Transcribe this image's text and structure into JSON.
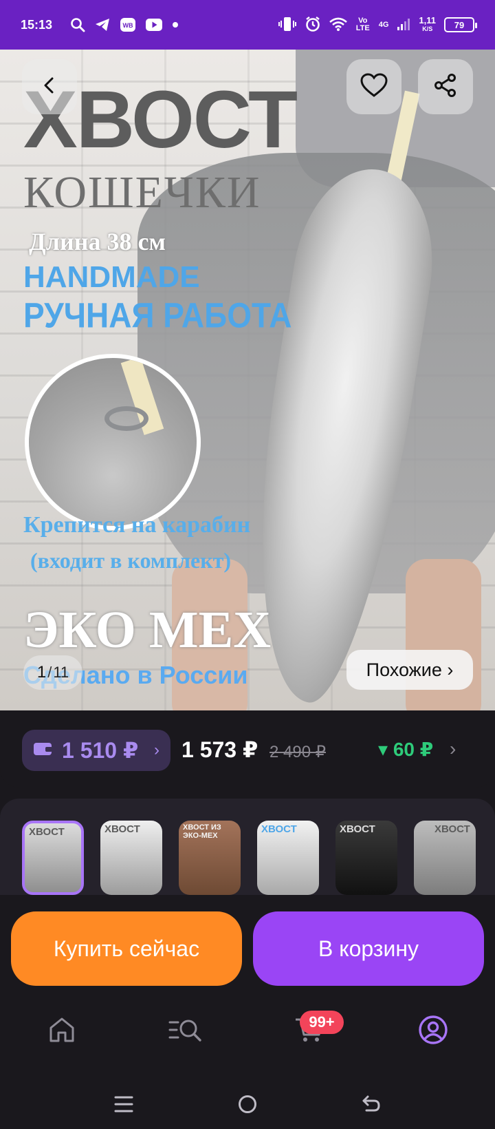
{
  "status_bar": {
    "time": "15:13",
    "network_type": "4G",
    "volte": "Vo LTE",
    "speed": "1,11",
    "speed_unit": "K/S",
    "battery": "79",
    "icons": [
      "search-icon",
      "telegram-icon",
      "wb-icon",
      "youtube-icon",
      "dot-icon",
      "vibrate-icon",
      "alarm-icon",
      "wifi-icon",
      "signal-icon",
      "battery-icon"
    ],
    "wb_label": "WB"
  },
  "hero": {
    "title": "ХВОСТ",
    "subtitle": "КОШЕЧКИ",
    "length_label": "Длина  38 см",
    "handmade_en": "HANDMADE",
    "handmade_ru": "РУЧНАЯ РАБОТА",
    "clip_line1": "Крепится на карабин",
    "clip_line2": "(входит в комплект)",
    "eco": "ЭКО МЕХ",
    "made_in": "Сделано в России",
    "page_current": "1",
    "page_separator": "/",
    "page_total": "11",
    "similar_label": "Похожие ›",
    "icons": [
      "back-icon",
      "heart-icon",
      "share-icon"
    ]
  },
  "price": {
    "wallet_price": "1 510 ₽",
    "wallet_chevron": "›",
    "main_price": "1 573 ₽",
    "old_price": "2 490 ₽",
    "cashback": "▾ 60 ₽",
    "chevron": "›",
    "colors": {
      "wallet": "#a98bef",
      "cashback": "#2ecb7a"
    }
  },
  "thumbnails": {
    "active_index": 0,
    "items": [
      {
        "label": "ХВОСТ"
      },
      {
        "label": "ХВОСТ"
      },
      {
        "label": "ХВОСТ ИЗ ЭКО-МЕХ"
      },
      {
        "label": "ХВОСТ"
      },
      {
        "label": "ХВОСТ"
      },
      {
        "label": "ХВОСТ"
      }
    ]
  },
  "actions": {
    "buy_now": "Купить сейчас",
    "add_to_cart": "В корзину",
    "colors": {
      "buy": "#ff8a24",
      "cart": "#9a45f5"
    }
  },
  "tab_bar": {
    "items": [
      {
        "name": "home",
        "icon": "home-icon"
      },
      {
        "name": "catalog",
        "icon": "catalog-search-icon"
      },
      {
        "name": "cart",
        "icon": "cart-icon"
      },
      {
        "name": "profile",
        "icon": "profile-icon"
      }
    ],
    "cart_badge": "99+"
  },
  "nav_bar": {
    "icons": [
      "menu-icon",
      "home-circle-icon",
      "back-arrow-icon"
    ]
  }
}
